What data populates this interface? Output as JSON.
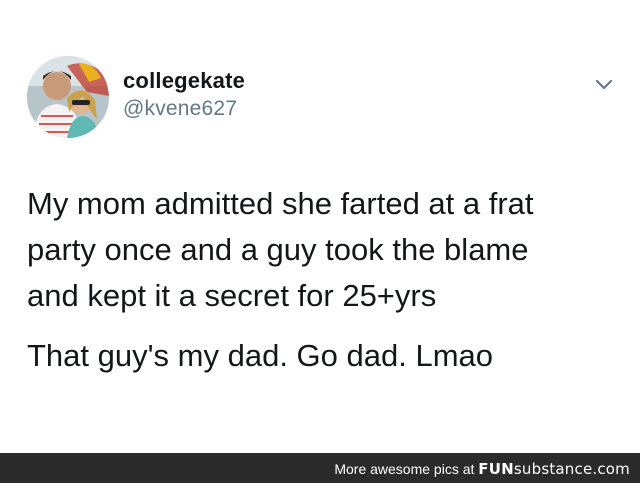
{
  "tweet": {
    "user": {
      "display_name": "collegekate",
      "handle": "@kvene627"
    },
    "icons": {
      "menu": "chevron-down-icon"
    },
    "text_lines": [
      "My mom admitted she farted at a frat",
      "party once and a guy took the blame",
      "and kept it a secret for 25+yrs"
    ],
    "text_second": "That guy's my dad. Go dad. Lmao"
  },
  "footer": {
    "prefix": "More awesome pics at ",
    "brand_strong": "FUN",
    "brand_rest": "substance",
    "brand_tld": ".com"
  },
  "colors": {
    "text": "#14171a",
    "handle": "#657786",
    "footer_bg": "#2b2b2b"
  }
}
